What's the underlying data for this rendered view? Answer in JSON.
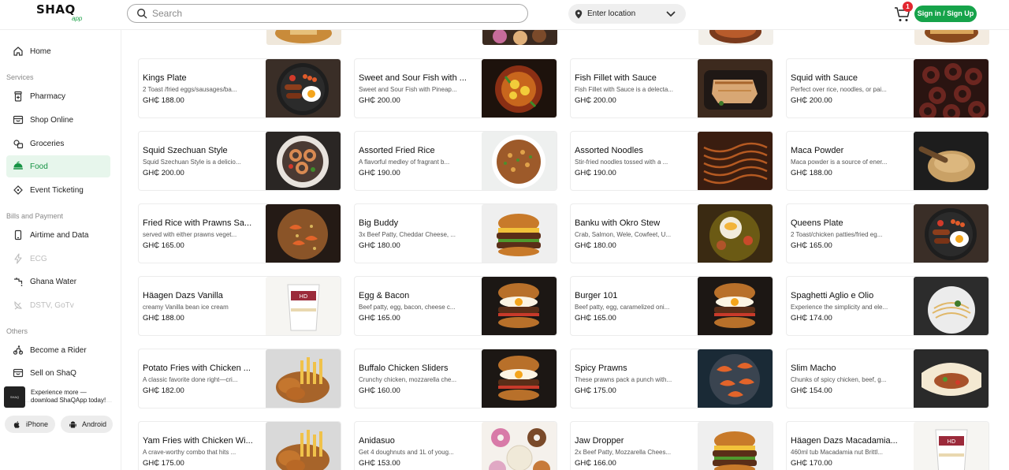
{
  "header": {
    "logo_main": "SHAQ",
    "logo_sub": "app",
    "search_placeholder": "Search",
    "location_label": "Enter location",
    "cart_count": "1",
    "signin_label": "Sign in / Sign Up"
  },
  "sidebar": {
    "home": "Home",
    "services_heading": "Services",
    "services": [
      "Pharmacy",
      "Shop Online",
      "Groceries",
      "Food",
      "Event Ticketing"
    ],
    "bills_heading": "Bills and Payment",
    "bills": [
      "Airtime and Data",
      "ECG",
      "Ghana Water",
      "DSTV, GoTv"
    ],
    "others_heading": "Others",
    "others": [
      "Become a Rider",
      "Sell on ShaQ"
    ],
    "promo_text": "Experience more — download ShaQApp today!",
    "ios_label": "iPhone",
    "android_label": "Android",
    "active_item": "Food"
  },
  "products": [
    {
      "name": "Kings Plate",
      "desc": "2 Toast /fried eggs/sausages/ba...",
      "price": "GH₵ 188.00",
      "img": "breakfast-plate"
    },
    {
      "name": "Sweet and Sour Fish with ...",
      "desc": "Sweet and Sour Fish with Pineap...",
      "price": "GH₵ 200.00",
      "img": "pineapple-fish"
    },
    {
      "name": "Fish Fillet with Sauce",
      "desc": "Fish Fillet with Sauce is a delecta...",
      "price": "GH₵ 200.00",
      "img": "fish-fillet"
    },
    {
      "name": "Squid with Sauce",
      "desc": "Perfect over rice, noodles, or pai...",
      "price": "GH₵ 200.00",
      "img": "squid"
    },
    {
      "name": "Squid Szechuan Style",
      "desc": "Squid Szechuan Style is a delicio...",
      "price": "GH₵ 200.00",
      "img": "squid-plate"
    },
    {
      "name": "Assorted Fried Rice",
      "desc": "A flavorful medley of fragrant b...",
      "price": "GH₵ 190.00",
      "img": "fried-rice"
    },
    {
      "name": "Assorted Noodles",
      "desc": "Stir-fried noodles tossed with a ...",
      "price": "GH₵ 190.00",
      "img": "noodles"
    },
    {
      "name": "Maca Powder",
      "desc": "Maca powder is a source of ener...",
      "price": "GH₵ 188.00",
      "img": "powder"
    },
    {
      "name": "Fried Rice with Prawns Sa...",
      "desc": "served with either prawns veget...",
      "price": "GH₵ 165.00",
      "img": "prawn-rice"
    },
    {
      "name": "Big Buddy",
      "desc": "3x Beef Patty, Cheddar Cheese, ...",
      "price": "GH₵ 180.00",
      "img": "burger"
    },
    {
      "name": "Banku with Okro Stew",
      "desc": "Crab, Salmon, Wele, Cowfeet, U...",
      "price": "GH₵ 180.00",
      "img": "banku"
    },
    {
      "name": "Queens Plate",
      "desc": "2 Toast/chicken patties/fried eg...",
      "price": "GH₵ 165.00",
      "img": "breakfast-plate"
    },
    {
      "name": "Häagen Dazs Vanilla",
      "desc": "creamy Vanilla bean ice cream",
      "price": "GH₵ 188.00",
      "img": "icecream"
    },
    {
      "name": "Egg & Bacon",
      "desc": "Beef patty, egg, bacon, cheese c...",
      "price": "GH₵ 165.00",
      "img": "burger-egg"
    },
    {
      "name": "Burger 101",
      "desc": "Beef patty, egg, caramelized oni...",
      "price": "GH₵ 165.00",
      "img": "burger-egg"
    },
    {
      "name": "Spaghetti Aglio e Olio",
      "desc": "Experience the simplicity and ele...",
      "price": "GH₵ 174.00",
      "img": "spaghetti"
    },
    {
      "name": "Potato Fries with Chicken ...",
      "desc": "A classic favorite done right—cri...",
      "price": "GH₵ 182.00",
      "img": "fries-chicken"
    },
    {
      "name": "Buffalo Chicken Sliders",
      "desc": "Crunchy chicken, mozzarella che...",
      "price": "GH₵ 160.00",
      "img": "burger-egg"
    },
    {
      "name": "Spicy Prawns",
      "desc": "These prawns pack a punch with...",
      "price": "GH₵ 175.00",
      "img": "prawns"
    },
    {
      "name": "Slim Macho",
      "desc": "Chunks of spicy chicken, beef, g...",
      "price": "GH₵ 154.00",
      "img": "wrap"
    },
    {
      "name": "Yam Fries with Chicken Wi...",
      "desc": "A crave-worthy combo that hits ...",
      "price": "GH₵ 175.00",
      "img": "fries-chicken"
    },
    {
      "name": "Anidasuo",
      "desc": "Get 4 doughnuts and 1L of youg...",
      "price": "GH₵ 153.00",
      "img": "donuts"
    },
    {
      "name": "Jaw Dropper",
      "desc": "2x Beef Patty, Mozzarella Chees...",
      "price": "GH₵ 166.00",
      "img": "burger"
    },
    {
      "name": "Häagen Dazs Macadamia...",
      "desc": "460ml tub Macadamia nut Brittl...",
      "price": "GH₵ 170.00",
      "img": "icecream"
    }
  ],
  "colors": {
    "brand_green": "#16a34a",
    "badge_red": "#e2262f",
    "active_bg": "#e7f6ec"
  }
}
